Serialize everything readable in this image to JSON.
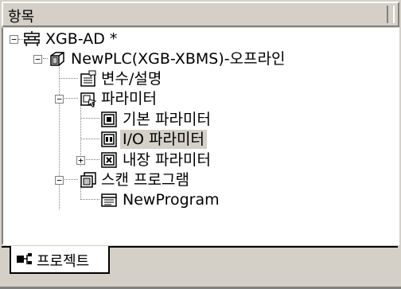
{
  "header": {
    "title": "항목"
  },
  "tree": {
    "root": {
      "label": "XGB-AD *",
      "expander": "−",
      "icon": "network-icon"
    },
    "plc": {
      "label": "NewPLC(XGB-XBMS)-오프라인",
      "expander": "−",
      "icon": "plc-cube-icon"
    },
    "variables": {
      "label": "변수/설명",
      "icon": "variable-comment-icon"
    },
    "parameters": {
      "label": "파라미터",
      "expander": "−",
      "icon": "parameter-folder-icon"
    },
    "basic_param": {
      "label": "기본 파라미터",
      "icon": "basic-parameter-icon"
    },
    "io_param": {
      "label": "I/O 파라미터",
      "icon": "io-parameter-icon",
      "selected": true
    },
    "builtin_param": {
      "label": "내장 파라미터",
      "expander": "+",
      "icon": "builtin-parameter-icon"
    },
    "scan_program": {
      "label": "스캔 프로그램",
      "expander": "−",
      "icon": "scan-program-icon"
    },
    "new_program": {
      "label": "NewProgram",
      "icon": "program-icon"
    }
  },
  "tabs": [
    {
      "label": "프로젝트",
      "icon": "project-tab-icon",
      "active": true
    }
  ]
}
